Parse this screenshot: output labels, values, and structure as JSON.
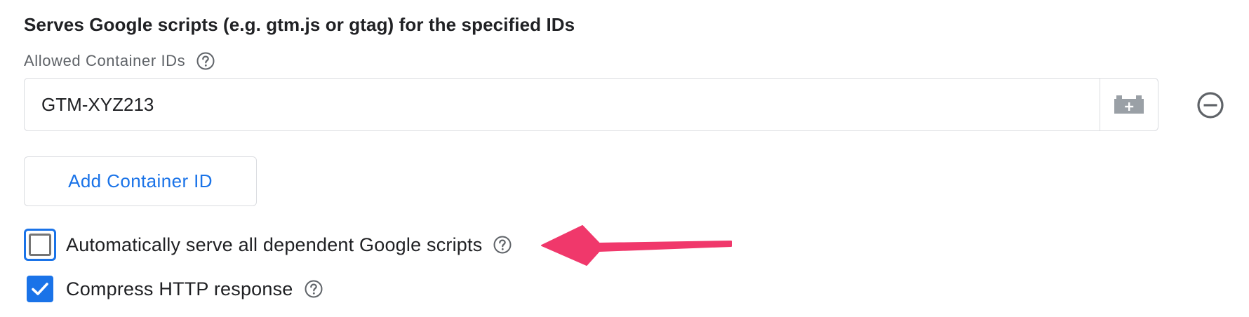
{
  "section": {
    "title": "Serves Google scripts (e.g. gtm.js or gtag) for the specified IDs"
  },
  "allowed_ids": {
    "label": "Allowed Container IDs",
    "value": "GTM-XYZ213"
  },
  "add_button": {
    "label": "Add Container ID"
  },
  "options": {
    "auto_serve": {
      "label": "Automatically serve all dependent Google scripts",
      "checked": false
    },
    "compress": {
      "label": "Compress HTTP response",
      "checked": true
    }
  },
  "colors": {
    "accent": "#1a73e8",
    "annotation_arrow": "#f0386b",
    "border": "#dadce0",
    "muted_text": "#5f6368"
  },
  "icons": {
    "help": "help-circle-icon",
    "variable": "variable-insert-icon",
    "remove": "remove-circle-icon",
    "check": "check-icon"
  }
}
